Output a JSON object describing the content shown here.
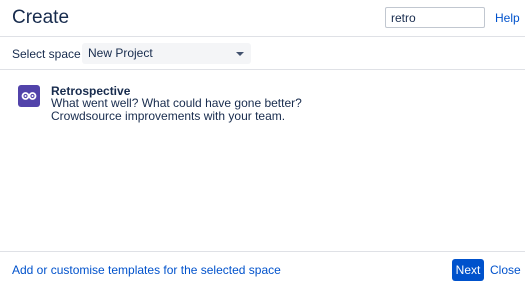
{
  "dialog": {
    "title": "Create",
    "search": {
      "value": "retro",
      "placeholder": ""
    },
    "help_label": "Help"
  },
  "space": {
    "label": "Select space",
    "selected": "New Project"
  },
  "templates": [
    {
      "name": "Retrospective",
      "description_lines": [
        "What went well? What could have gone better?",
        "Crowdsource improvements with your team."
      ],
      "icon": "retrospective-icon",
      "icon_color": "#5243aa"
    }
  ],
  "footer": {
    "customise_link": "Add or customise templates for the selected space",
    "next_label": "Next",
    "close_label": "Close"
  },
  "colors": {
    "accent": "#0052cc",
    "text": "#172b4d",
    "divider": "#dfe1e6"
  }
}
